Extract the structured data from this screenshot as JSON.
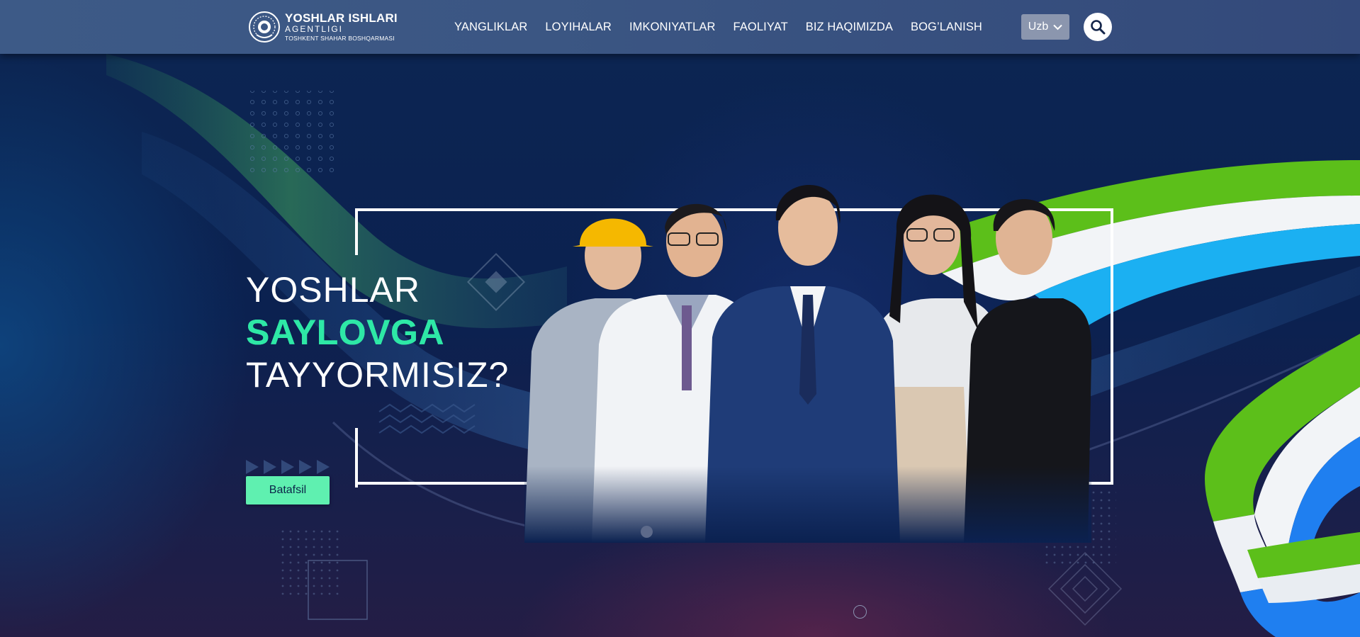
{
  "header": {
    "logo": {
      "line1": "YOSHLAR ISHLARI",
      "line2": "AGENTLIGI",
      "line3": "TOSHKENT SHAHAR BOSHQARMASI"
    },
    "nav": [
      {
        "label": "YANGLIKLAR"
      },
      {
        "label": "LOYIHALAR"
      },
      {
        "label": "IMKONIYATLAR"
      },
      {
        "label": "FAOLIYAT"
      },
      {
        "label": "BIZ HAQIMIZDA"
      },
      {
        "label": "BOG’LANISH"
      }
    ],
    "language": "Uzb",
    "search_icon": "search-icon"
  },
  "hero": {
    "headline_line1": "YOSHLAR",
    "headline_line2": "SAYLOVGA",
    "headline_line3": "TAYYORMISIZ?",
    "cta_label": "Batafsil"
  },
  "colors": {
    "header_bg": "#3b5683",
    "accent_green": "#2ee8a6",
    "button_bg": "#5ff0b0",
    "hero_bg": "#0b2150",
    "flag_green": "#5cbf1a",
    "flag_blue": "#1aa0f0"
  }
}
